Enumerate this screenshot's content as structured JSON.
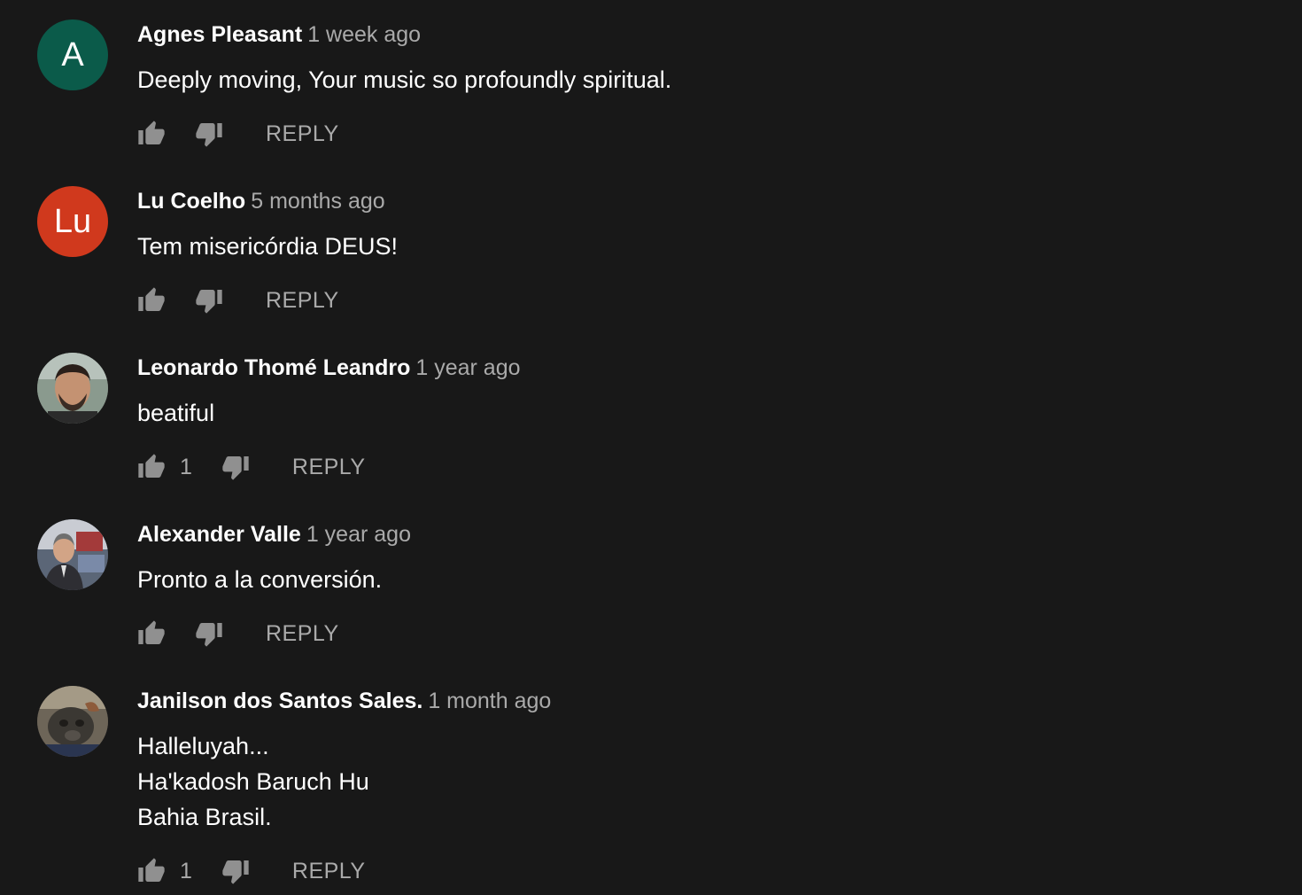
{
  "comments": [
    {
      "author": "Agnes Pleasant",
      "time": "1 week ago",
      "text_lines": [
        "Deeply moving, Your music so profoundly spiritual."
      ],
      "likes": "",
      "avatar": {
        "type": "letter",
        "letter": "A",
        "color": "#0b5b4a"
      },
      "reply_label": "REPLY"
    },
    {
      "author": "Lu Coelho",
      "time": "5 months ago",
      "text_lines": [
        "Tem misericórdia DEUS!"
      ],
      "likes": "",
      "avatar": {
        "type": "letter",
        "letter": "Lu",
        "color": "#d0391d"
      },
      "reply_label": "REPLY"
    },
    {
      "author": "Leonardo Thomé Leandro",
      "time": "1 year ago",
      "text_lines": [
        "beatiful"
      ],
      "likes": "1",
      "avatar": {
        "type": "photo",
        "icon": "person-photo"
      },
      "reply_label": "REPLY"
    },
    {
      "author": "Alexander Valle",
      "time": "1 year ago",
      "text_lines": [
        "Pronto a la conversión."
      ],
      "likes": "",
      "avatar": {
        "type": "photo",
        "icon": "person-photo"
      },
      "reply_label": "REPLY"
    },
    {
      "author": "Janilson dos Santos Sales.",
      "time": "1 month ago",
      "text_lines": [
        "Halleluyah...",
        "Ha'kadosh Baruch Hu",
        "Bahia Brasil."
      ],
      "likes": "1",
      "avatar": {
        "type": "photo",
        "icon": "animal-photo"
      },
      "reply_label": "REPLY"
    }
  ],
  "icons": {
    "like": "thumb-up-icon",
    "dislike": "thumb-down-icon"
  },
  "colors": {
    "background": "#181818",
    "secondary_text": "#aaaaaa",
    "icon": "#909090"
  }
}
